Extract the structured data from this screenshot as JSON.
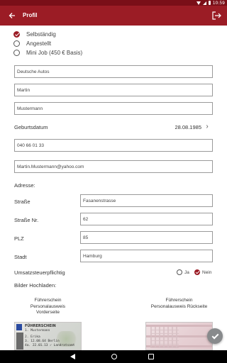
{
  "status_bar": {
    "time": "10:59"
  },
  "app_bar": {
    "title": "Profil"
  },
  "employment": {
    "options": [
      {
        "label": "Selbständig",
        "selected": true
      },
      {
        "label": "Angestellt",
        "selected": false
      },
      {
        "label": "Mini Job (450 € Basis)",
        "selected": false
      }
    ]
  },
  "fields": {
    "company": "Deutsche Autos",
    "first_name": "Martin",
    "last_name": "Mustermann",
    "phone": "040 66 01 33",
    "email": "Martin.Mustermann@yahoo.com"
  },
  "birthdate": {
    "label": "Geburtsdatum",
    "value": "28.08.1985"
  },
  "address": {
    "heading": "Adresse:",
    "street_label": "Straße",
    "street_value": "Fasanenstrasse",
    "number_label": "Straße Nr.",
    "number_value": "62",
    "zip_label": "PLZ",
    "zip_value": "85",
    "city_label": "Stadt",
    "city_value": "Hamburg"
  },
  "tax": {
    "label": "Umsatzsteuerpflichtig",
    "yes_label": "Ja",
    "no_label": "Nein",
    "selected": "Nein"
  },
  "upload": {
    "heading": "Bilder Hochladen:",
    "front_caption": [
      "Führerschein",
      "Personalausweis",
      "Vorderseite"
    ],
    "back_caption": [
      "Führerschein",
      "Personalausweis Rückseite"
    ],
    "front_card_text": {
      "header": "FÜHRERSCHEIN",
      "lines": [
        "1.  Mustermann",
        "2.  Erika",
        "3.  12.08.64  Berlin",
        "4a. 22.01.13  ✓ Landratsamt"
      ]
    }
  },
  "colors": {
    "primary": "#9b1c25",
    "status_bar": "#7a0f18",
    "fab": "#888a8c"
  },
  "icons": {
    "app_back": "arrow-left-icon",
    "logout": "logout-icon",
    "chevron": "chevron-right-icon",
    "fab": "check-icon"
  }
}
